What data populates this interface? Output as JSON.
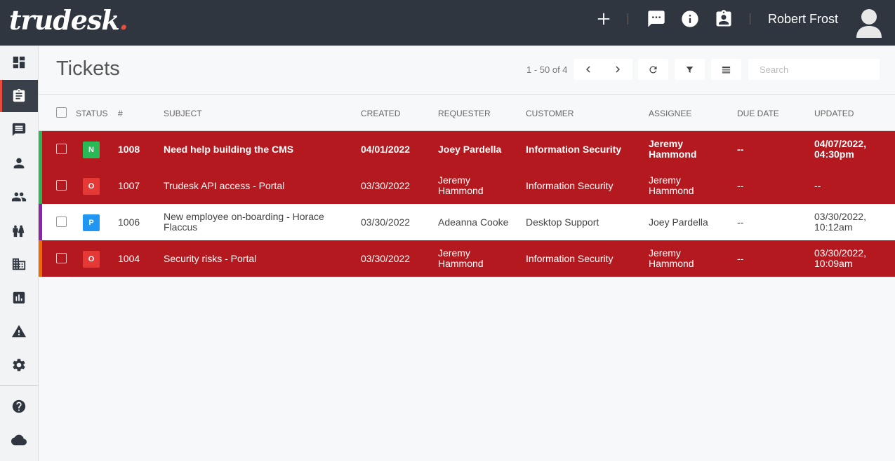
{
  "app": {
    "logo_text": "trudesk",
    "logo_dot": ".",
    "username": "Robert Frost",
    "accent_color": "#e74c3c",
    "topbar_icons": [
      "add-icon",
      "chat-icon",
      "info-icon",
      "assignment-icon"
    ]
  },
  "sidebar": {
    "items": [
      {
        "name": "dashboard-icon",
        "active": false
      },
      {
        "name": "tickets-icon",
        "active": true
      },
      {
        "name": "messages-icon",
        "active": false
      },
      {
        "name": "accounts-icon",
        "active": false
      },
      {
        "name": "groups-icon",
        "active": false
      },
      {
        "name": "teams-icon",
        "active": false
      },
      {
        "name": "departments-icon",
        "active": false
      },
      {
        "name": "reports-icon",
        "active": false
      },
      {
        "name": "notices-icon",
        "active": false
      },
      {
        "name": "settings-icon",
        "active": false
      },
      {
        "name": "help-icon",
        "active": false
      },
      {
        "name": "cloud-icon",
        "active": false
      }
    ]
  },
  "page": {
    "title": "Tickets",
    "pager": "1 - 50 of 4",
    "search_placeholder": "Search"
  },
  "table": {
    "headers": {
      "status": "STATUS",
      "number": "#",
      "subject": "SUBJECT",
      "created": "CREATED",
      "requester": "REQUESTER",
      "customer": "CUSTOMER",
      "assignee": "ASSIGNEE",
      "due_date": "DUE DATE",
      "updated": "UPDATED"
    },
    "rows": [
      {
        "status": "N",
        "status_color": "#29b955",
        "stripe_color": "#29b955",
        "row_style": "red",
        "number": "1008",
        "subject": "Need help building the CMS",
        "created": "04/01/2022",
        "requester": "Joey Pardella",
        "customer": "Information Security",
        "assignee": "Jeremy Hammond",
        "due_date": "--",
        "updated": "04/07/2022, 04:30pm"
      },
      {
        "status": "O",
        "status_color": "#e53935",
        "stripe_color": "#29b955",
        "row_style": "red",
        "number": "1007",
        "subject": "Trudesk API access - Portal",
        "created": "03/30/2022",
        "requester": "Jeremy Hammond",
        "customer": "Information Security",
        "assignee": "Jeremy Hammond",
        "due_date": "--",
        "updated": "--"
      },
      {
        "status": "P",
        "status_color": "#2196f3",
        "stripe_color": "#8e24aa",
        "row_style": "white",
        "number": "1006",
        "subject": "New employee on-boarding - Horace Flaccus",
        "created": "03/30/2022",
        "requester": "Adeanna Cooke",
        "customer": "Desktop Support",
        "assignee": "Joey Pardella",
        "due_date": "--",
        "updated": "03/30/2022, 10:12am"
      },
      {
        "status": "O",
        "status_color": "#e53935",
        "stripe_color": "#ef6c00",
        "row_style": "red",
        "number": "1004",
        "subject": "Security risks - Portal",
        "created": "03/30/2022",
        "requester": "Jeremy Hammond",
        "customer": "Information Security",
        "assignee": "Jeremy Hammond",
        "due_date": "--",
        "updated": "03/30/2022, 10:09am"
      }
    ]
  }
}
